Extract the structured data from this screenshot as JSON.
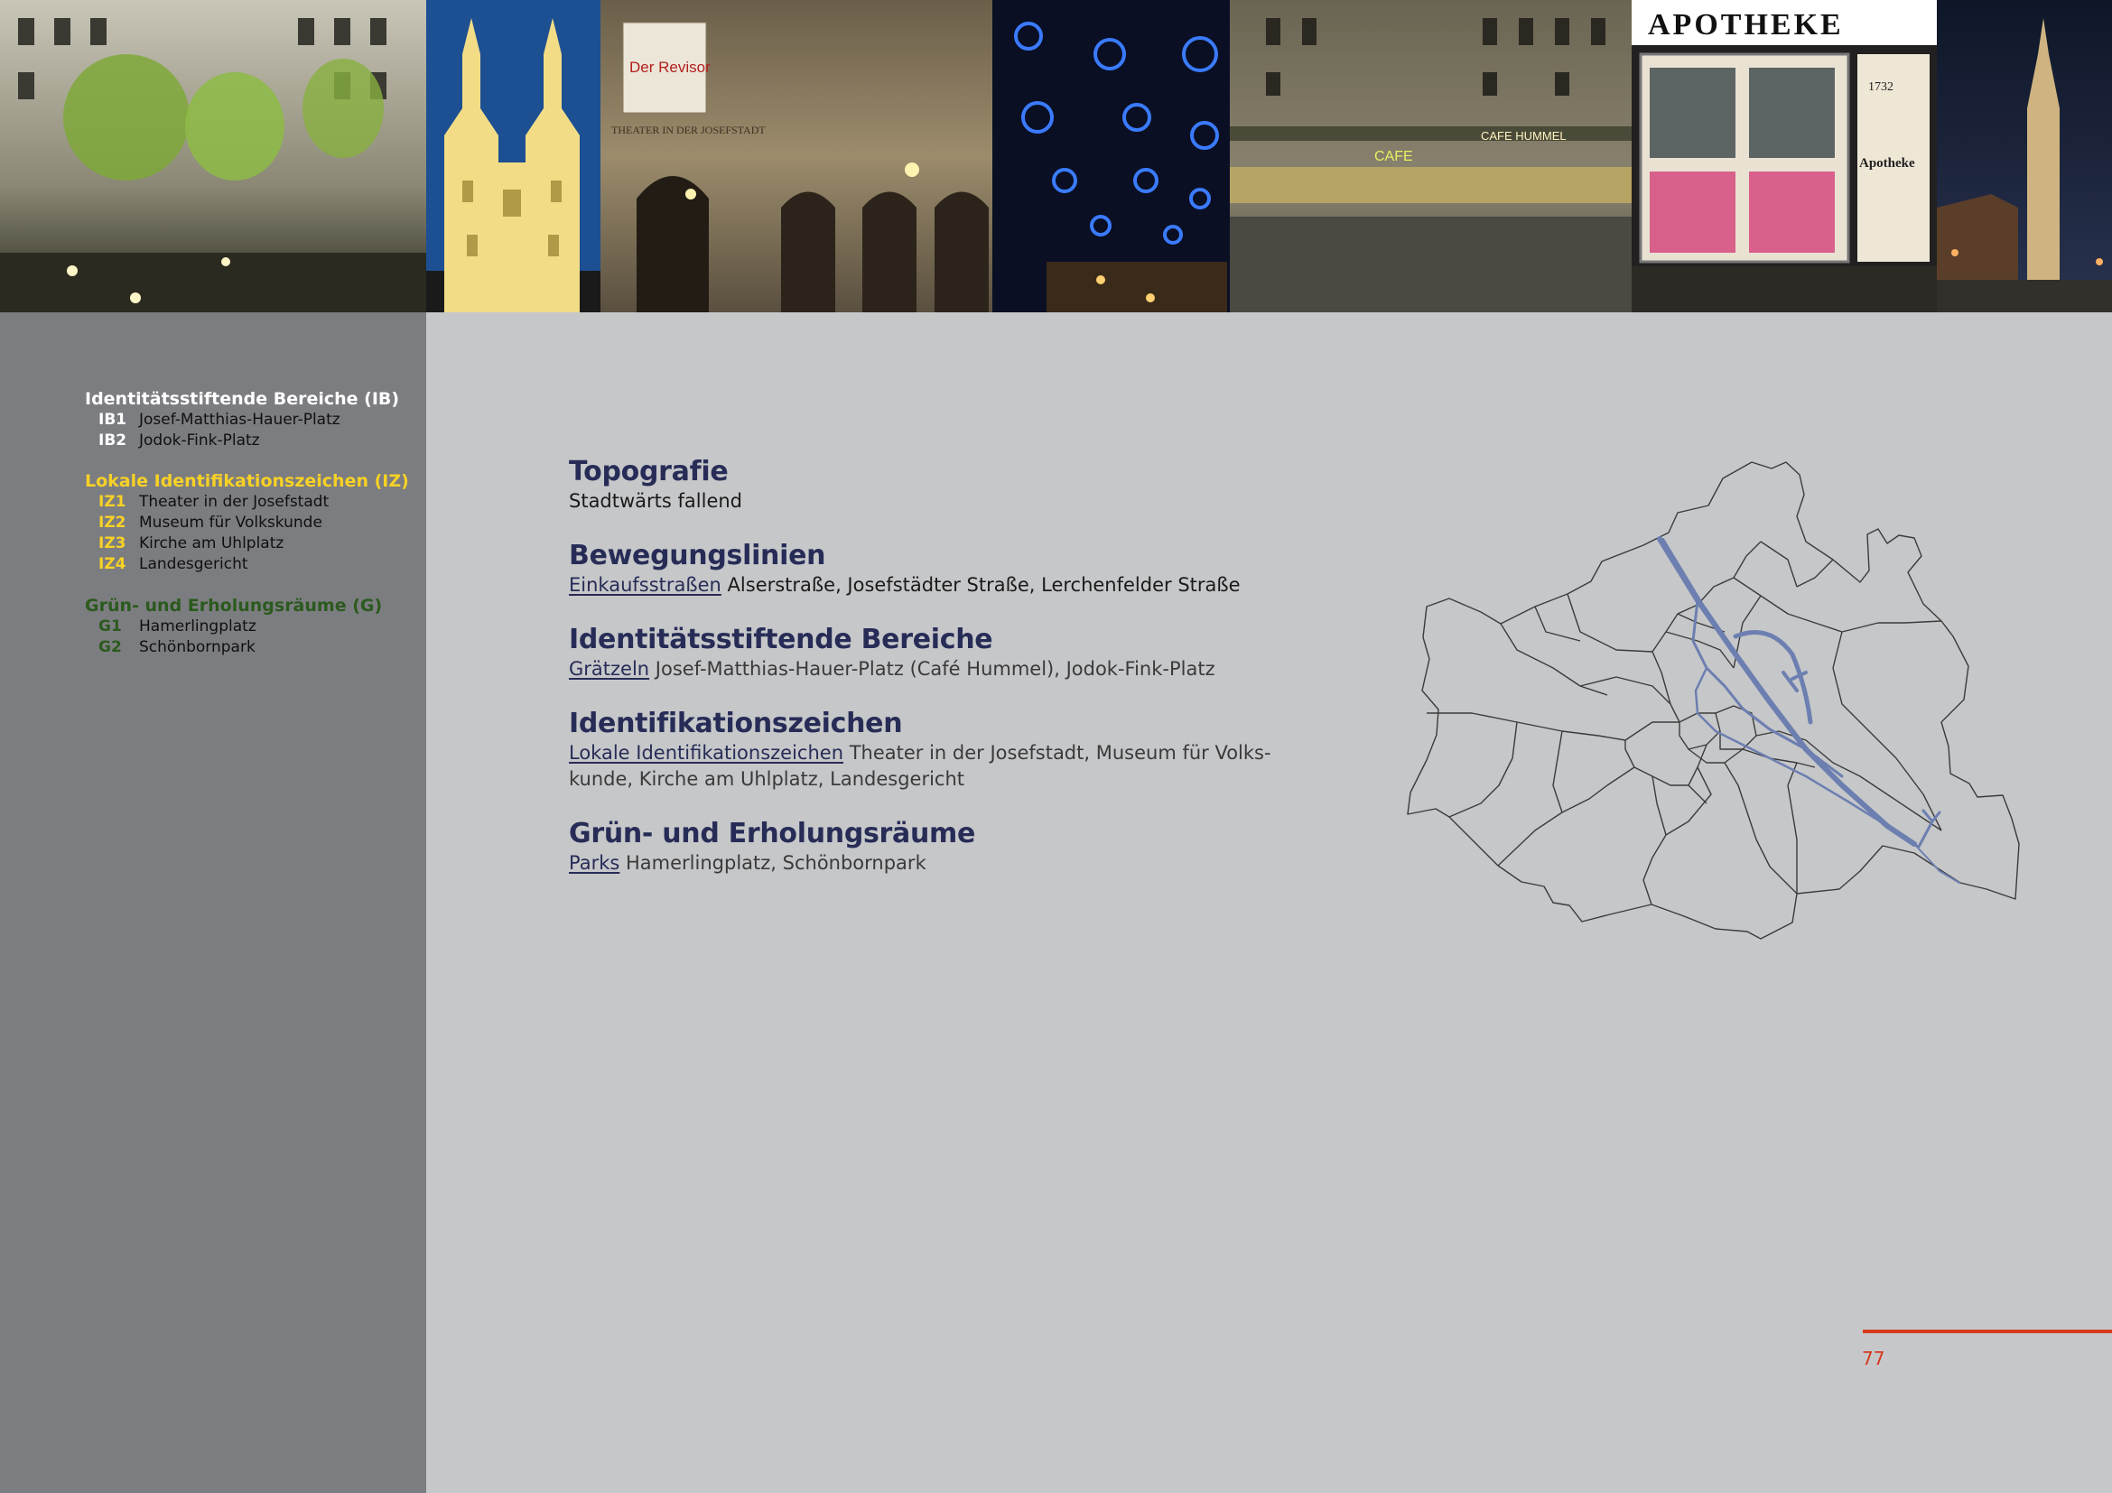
{
  "legend": {
    "groups": [
      {
        "title": "Identitätsstiftende Bereiche (IB)",
        "items": [
          {
            "code": "IB1",
            "label": "Josef-Matthias-Hauer-Platz"
          },
          {
            "code": "IB2",
            "label": "Jodok-Fink-Platz"
          }
        ]
      },
      {
        "title": "Lokale Identifikationszeichen (IZ)",
        "items": [
          {
            "code": "IZ1",
            "label": "Theater in der Josefstadt"
          },
          {
            "code": "IZ2",
            "label": "Museum für Volkskunde"
          },
          {
            "code": "IZ3",
            "label": "Kirche am Uhlplatz"
          },
          {
            "code": "IZ4",
            "label": "Landesgericht"
          }
        ]
      },
      {
        "title": "Grün- und Erholungsräume (G)",
        "items": [
          {
            "code": "G1",
            "label": "Hamerlingplatz"
          },
          {
            "code": "G2",
            "label": "Schönbornpark"
          }
        ]
      }
    ]
  },
  "sections": [
    {
      "heading": "Topografie",
      "lead": "",
      "text": "Stadtwärts fallend"
    },
    {
      "heading": "Bewegungslinien",
      "lead": "Einkaufsstraßen",
      "text": "Alserstraße, Josefstädter Straße, Lerchenfelder Straße"
    },
    {
      "heading": "Identitätsstiftende Bereiche",
      "lead": "Grätzeln",
      "text": "Josef-Matthias-Hauer-Platz (Café Hummel), Jodok-Fink-Platz"
    },
    {
      "heading": "Identifikationszeichen",
      "lead": "Lokale Identifikationszeichen",
      "text": "Theater in der Josefstadt, Museum für Volks­kunde, Kirche am Uhlplatz, Landesgericht"
    },
    {
      "heading": "Grün- und Erholungsräume",
      "lead": "Parks",
      "text": "Hamerlingplatz, Schönbornpark"
    }
  ],
  "photo_signs": {
    "theater_poster": "Der Revisor",
    "theater_facade": "THEATER IN DER JOSEFSTADT",
    "cafe_sign": "CAFE HUMMEL",
    "cafe_neon": "CAFE",
    "pharmacy_sign": "APOTHEKE",
    "pharmacy_window": "Apotheke",
    "pharmacy_year": "1732"
  },
  "page_number": "77",
  "colors": {
    "heading": "#272c57",
    "sidebar": "#7c7d80",
    "page_bg": "#c6c7c9",
    "accent_red": "#d5391e",
    "legend_yellow": "#f7d126",
    "legend_green": "#2b5a1e",
    "map_highlight": "#6c7fb0"
  }
}
